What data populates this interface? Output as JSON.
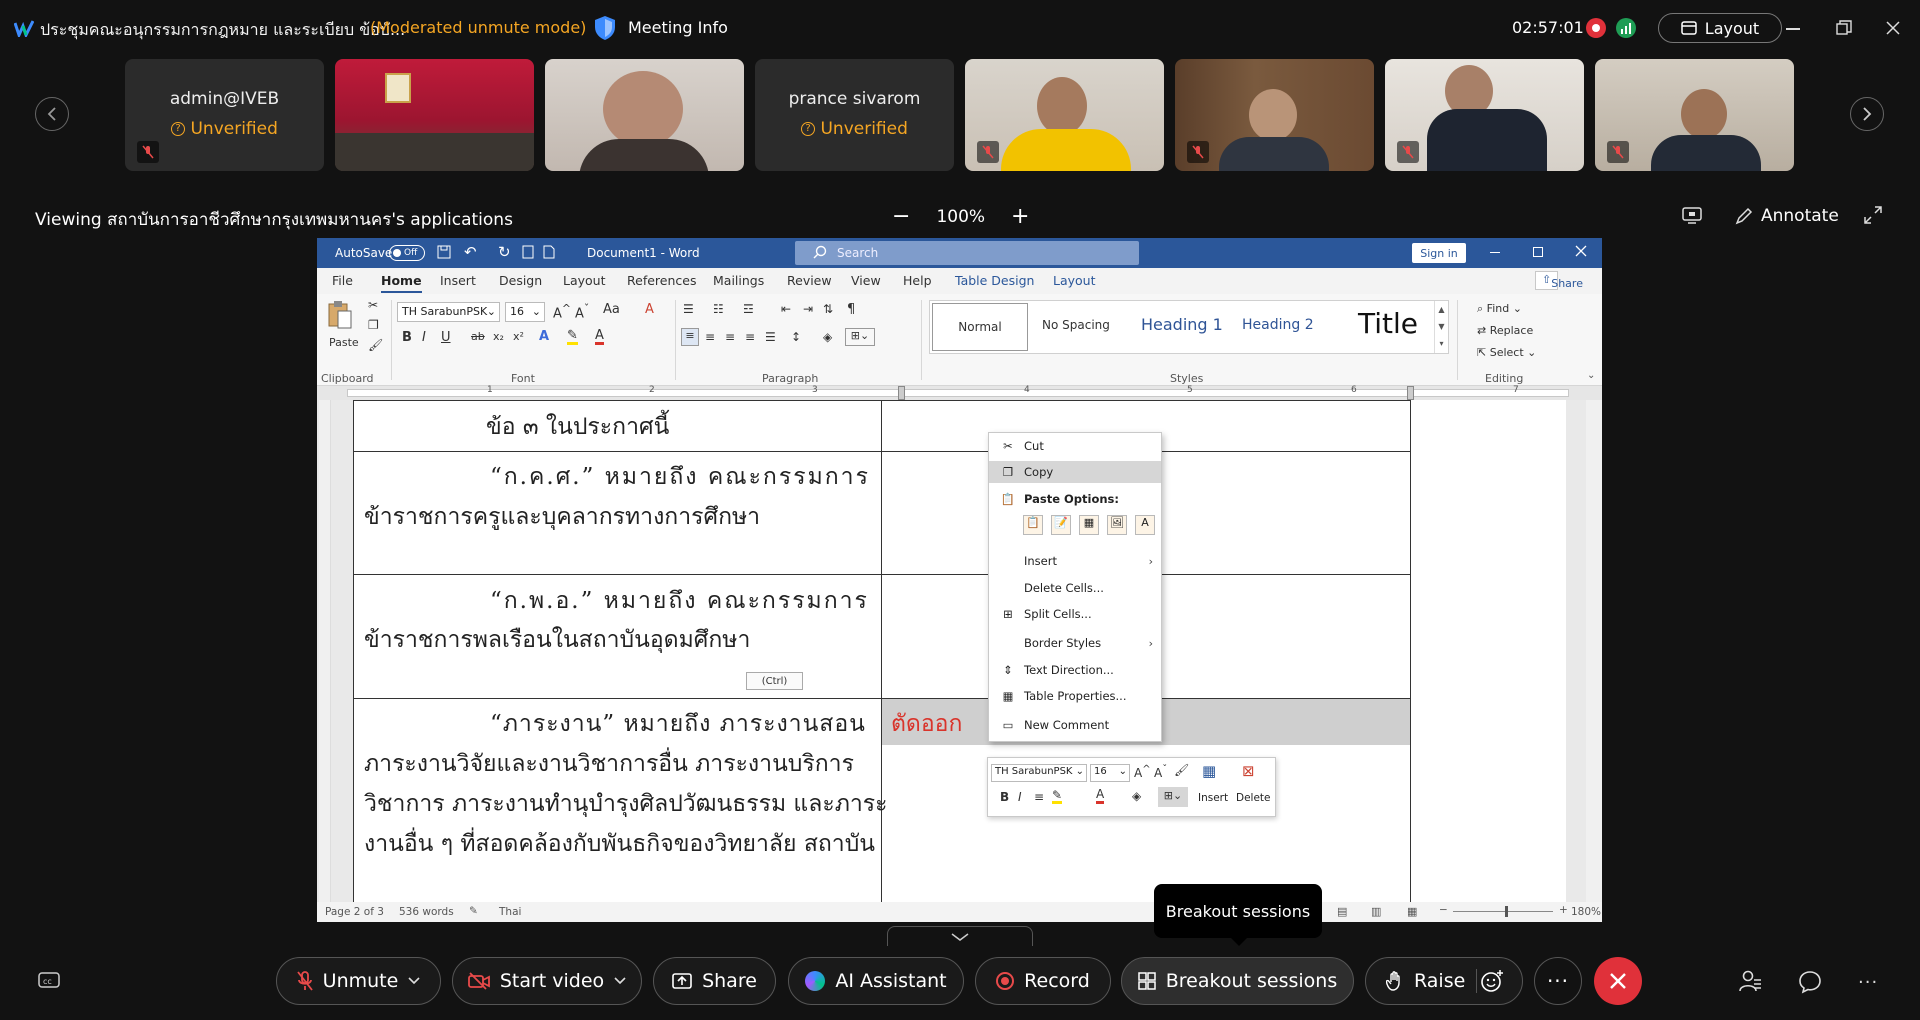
{
  "meeting": {
    "title": "ประชุมคณะอนุกรรมการกฎหมาย และระเบียบ ข้อบั...",
    "mode": "(Moderated unmute mode)",
    "info_label": "Meeting Info",
    "timer": "02:57:01",
    "layout_label": "Layout"
  },
  "participants": [
    {
      "name": "admin@IVEB",
      "status": "Unverified",
      "muted": true
    },
    {
      "name": "",
      "status": "",
      "muted": false
    },
    {
      "name": "",
      "status": "",
      "muted": false
    },
    {
      "name": "prance sivarom",
      "status": "Unverified",
      "muted": false
    },
    {
      "name": "",
      "status": "",
      "muted": true
    },
    {
      "name": "",
      "status": "",
      "muted": true
    },
    {
      "name": "",
      "status": "",
      "muted": true
    },
    {
      "name": "",
      "status": "",
      "muted": true
    }
  ],
  "share": {
    "viewing_prefix": "Viewing ",
    "presenter": "สถาบันการอาชีวศึกษากรุงเทพมหานคร",
    "viewing_suffix": "'s applications",
    "zoom": "100%",
    "annotate_label": "Annotate"
  },
  "word": {
    "autosave": "AutoSave",
    "autosave_state": "Off",
    "doc_title": "Document1 - Word",
    "search_placeholder": "Search",
    "sign_in": "Sign in",
    "menu_tabs": [
      "File",
      "Home",
      "Insert",
      "Design",
      "Layout",
      "References",
      "Mailings",
      "Review",
      "View",
      "Help",
      "Table Design",
      "Layout"
    ],
    "share_label": "Share",
    "font_name": "TH SarabunPSK",
    "font_size": "16",
    "paste_label": "Paste",
    "group_labels": {
      "clipboard": "Clipboard",
      "font": "Font",
      "paragraph": "Paragraph",
      "styles": "Styles",
      "editing": "Editing"
    },
    "styles": [
      "Normal",
      "No Spacing",
      "Heading 1",
      "Heading 2",
      "Title"
    ],
    "editing": [
      "Find",
      "Replace",
      "Select"
    ],
    "status": {
      "page": "Page 2 of 3",
      "words": "536 words",
      "language": "Thai",
      "zoom": "180%"
    }
  },
  "document": {
    "rows": [
      {
        "lines": [
          "ข้อ ๓ ในประกาศนี้"
        ]
      },
      {
        "lines": [
          "“ก.ค.ศ.” หมายถึง คณะกรรมการ",
          "ข้าราชการครูและบุคลากรทางการศึกษา"
        ]
      },
      {
        "lines": [
          "“ก.พ.อ.” หมายถึง คณะกรรมการ",
          "ข้าราชการพลเรือนในสถาบันอุดมศึกษา"
        ]
      },
      {
        "lines": [
          "“ภาระงาน” หมายถึง ภาระงานสอน",
          "ภาระงานวิจัยและงานวิชาการอื่น ภาระงานบริการ",
          "วิชาการ ภาระงานทำนุบำรุงศิลปวัฒนธรรม และภาระ",
          "งานอื่น ๆ ที่สอดคล้องกับพันธกิจของวิทยาลัย สถาบัน"
        ]
      }
    ],
    "cut_text": "ตัดออก",
    "paste_ctrl": "(Ctrl)"
  },
  "context_menu": {
    "cut": "Cut",
    "copy": "Copy",
    "paste_options": "Paste Options:",
    "insert": "Insert",
    "delete_cells": "Delete Cells...",
    "split_cells": "Split Cells...",
    "border_styles": "Border Styles",
    "text_direction": "Text Direction...",
    "table_properties": "Table Properties...",
    "new_comment": "New Comment"
  },
  "mini_toolbar": {
    "font": "TH SarabunPSK",
    "size": "16",
    "insert": "Insert",
    "delete": "Delete"
  },
  "toolbar": {
    "unmute": "Unmute",
    "start_video": "Start video",
    "share": "Share",
    "ai_assistant": "AI Assistant",
    "record": "Record",
    "breakout": "Breakout sessions",
    "raise": "Raise",
    "tooltip": "Breakout sessions"
  },
  "colors": {
    "accent_warn": "#f5a623",
    "end_call": "#e0313a",
    "word_blue": "#2b579a",
    "cut_red": "#d9342b"
  }
}
